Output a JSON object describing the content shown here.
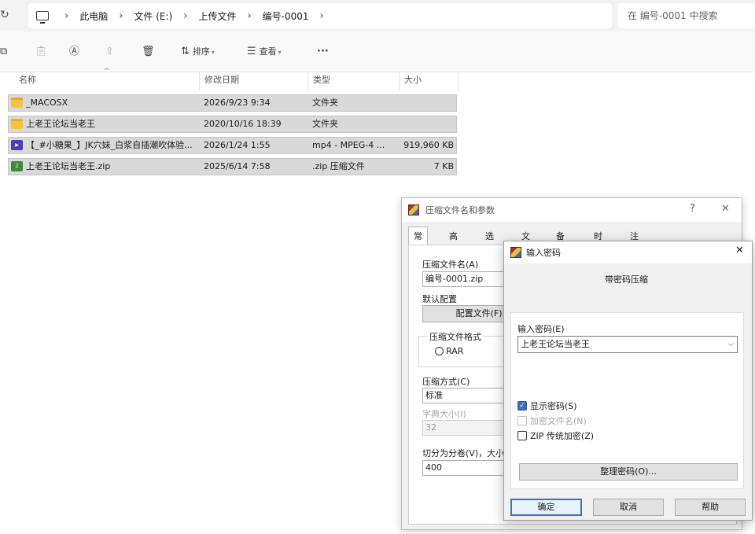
{
  "explorer": {
    "breadcrumbs": [
      "此电脑",
      "文件 (E:)",
      "上传文件",
      "编号-0001"
    ],
    "search_placeholder": "在 编号-0001 中搜索",
    "toolbar": {
      "sort_label": "排序",
      "view_label": "查看",
      "more_label": "···"
    },
    "columns": {
      "name": "名称",
      "date": "修改日期",
      "type": "类型",
      "size": "大小"
    },
    "files": [
      {
        "name": "_MACOSX",
        "date": "2026/9/23 9:34",
        "type": "文件夹",
        "size": "",
        "icon": "folder-icon"
      },
      {
        "name": "上老王论坛当老王",
        "date": "2020/10/16 18:39",
        "type": "文件夹",
        "size": "",
        "icon": "folder-icon"
      },
      {
        "name": "【_#小糖果_】JK穴妹_白浆自插潮吹体验...",
        "date": "2026/1/24 1:55",
        "type": "mp4 - MPEG-4 ...",
        "size": "919,960 KB",
        "icon": "video-file-icon"
      },
      {
        "name": "上老王论坛当老王.zip",
        "date": "2025/6/14 7:58",
        "type": ".zip 压缩文件",
        "size": "7 KB",
        "icon": "zip-file-icon"
      }
    ]
  },
  "archive_dialog": {
    "title": "压缩文件名和参数",
    "help": "?",
    "close": "✕",
    "tabs": [
      "常规",
      "高级",
      "选项",
      "文件",
      "备份",
      "时间",
      "注释"
    ],
    "archive_name_label": "压缩文件名(A)",
    "archive_name_value": "编号-0001.zip",
    "default_profile_label": "默认配置",
    "profile_button": "配置文件(F)...",
    "format_group_label": "压缩文件格式",
    "format_rar": "RAR",
    "method_label": "压缩方式(C)",
    "method_value": "标准",
    "dict_label": "字典大小(I)",
    "dict_value": "32",
    "split_label": "切分为分卷(V)，大小",
    "split_value": "400"
  },
  "password_dialog": {
    "title": "输入密码",
    "close": "✕",
    "heading": "带密码压缩",
    "input_label": "输入密码(E)",
    "input_value": "上老王论坛当老王",
    "show_password": "显示密码(S)",
    "encrypt_names": "加密文件名(N)",
    "zip_legacy": "ZIP 传统加密(Z)",
    "organize_button": "整理密码(O)...",
    "ok": "确定",
    "cancel": "取消",
    "help": "帮助",
    "checked": {
      "show_password": true,
      "encrypt_names": false,
      "zip_legacy": false
    }
  },
  "colors": {
    "accent": "#3c6fb8",
    "selection": "#d9d9d9",
    "folder": "#f5c542"
  }
}
